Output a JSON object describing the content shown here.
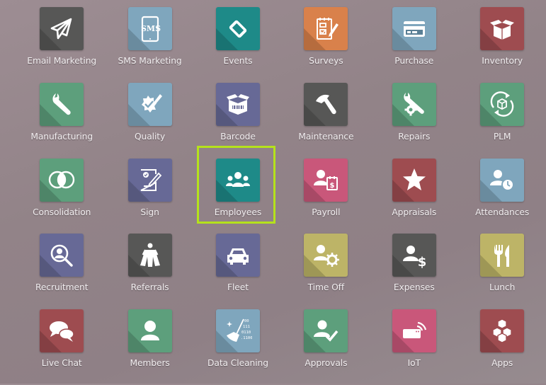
{
  "apps": [
    {
      "label": "Email Marketing",
      "icon": "paper-plane-icon",
      "color": "#575756"
    },
    {
      "label": "SMS Marketing",
      "icon": "sms-phone-icon",
      "color": "#7fa6bd"
    },
    {
      "label": "Events",
      "icon": "ticket-icon",
      "color": "#1e8a88"
    },
    {
      "label": "Surveys",
      "icon": "clipboard-pencil-icon",
      "color": "#d9814b"
    },
    {
      "label": "Purchase",
      "icon": "credit-card-icon",
      "color": "#7fa6bd"
    },
    {
      "label": "Inventory",
      "icon": "open-box-icon",
      "color": "#9e4c50"
    },
    {
      "label": "Manufacturing",
      "icon": "wrench-icon",
      "color": "#5d9f7c"
    },
    {
      "label": "Quality",
      "icon": "badge-check-pencil-icon",
      "color": "#7fa6bd"
    },
    {
      "label": "Barcode",
      "icon": "barcode-box-icon",
      "color": "#676996"
    },
    {
      "label": "Maintenance",
      "icon": "hammer-icon",
      "color": "#575756"
    },
    {
      "label": "Repairs",
      "icon": "wrench-gear-icon",
      "color": "#5d9f7c"
    },
    {
      "label": "PLM",
      "icon": "cycle-box-icon",
      "color": "#5d9f7c"
    },
    {
      "label": "Consolidation",
      "icon": "overlapping-circles-icon",
      "color": "#5d9f7c"
    },
    {
      "label": "Sign",
      "icon": "signed-document-icon",
      "color": "#676996"
    },
    {
      "label": "Employees",
      "icon": "people-group-icon",
      "color": "#1e8a88"
    },
    {
      "label": "Payroll",
      "icon": "person-calendar-dollar-icon",
      "color": "#c9577a"
    },
    {
      "label": "Appraisals",
      "icon": "star-icon",
      "color": "#9e4c50"
    },
    {
      "label": "Attendances",
      "icon": "person-clock-icon",
      "color": "#7fa6bd"
    },
    {
      "label": "Recruitment",
      "icon": "search-person-icon",
      "color": "#676996"
    },
    {
      "label": "Referrals",
      "icon": "superhero-icon",
      "color": "#575756"
    },
    {
      "label": "Fleet",
      "icon": "car-icon",
      "color": "#676996"
    },
    {
      "label": "Time Off",
      "icon": "person-gear-icon",
      "color": "#bdb467"
    },
    {
      "label": "Expenses",
      "icon": "person-dollar-icon",
      "color": "#575756"
    },
    {
      "label": "Lunch",
      "icon": "fork-knife-icon",
      "color": "#bdb467"
    },
    {
      "label": "Live Chat",
      "icon": "chat-bubbles-icon",
      "color": "#9e4c50"
    },
    {
      "label": "Members",
      "icon": "person-icon",
      "color": "#5d9f7c"
    },
    {
      "label": "Data Cleaning",
      "icon": "broom-binary-icon",
      "color": "#7fa6bd"
    },
    {
      "label": "Approvals",
      "icon": "person-check-icon",
      "color": "#5d9f7c"
    },
    {
      "label": "IoT",
      "icon": "iot-device-icon",
      "color": "#c9577a"
    },
    {
      "label": "Apps",
      "icon": "cubes-icon",
      "color": "#9e4c50"
    }
  ],
  "highlight": {
    "app": "Employees",
    "color": "#b5e21b"
  },
  "sms_text": "SMS",
  "binary_lines": [
    "00",
    "111",
    "0110",
    ".1100"
  ],
  "dollar": "$"
}
